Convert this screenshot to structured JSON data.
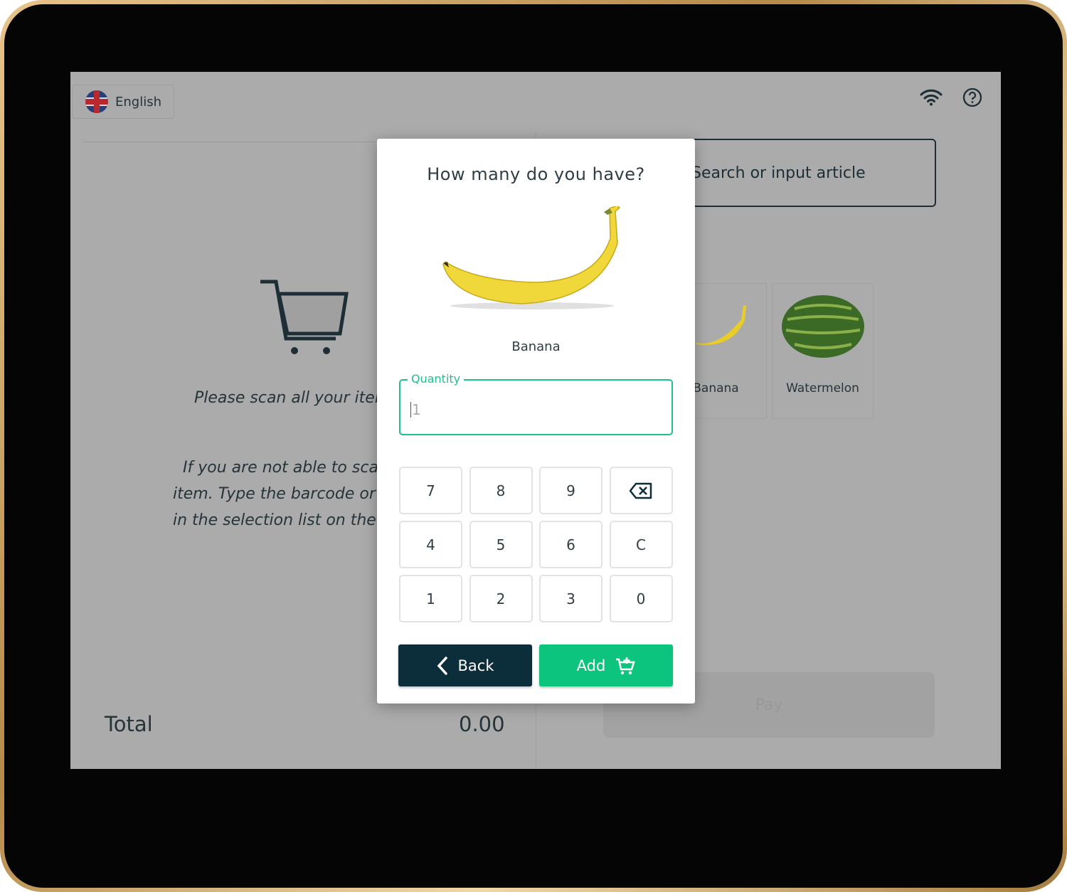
{
  "header": {
    "language": "English",
    "icons": [
      "wifi-icon",
      "help-icon"
    ]
  },
  "search": {
    "placeholder": "Search or input article"
  },
  "left": {
    "scan_text": "Please scan all your items",
    "help_text": [
      "If you are not able to scan an",
      "item. Type the barcode or choose",
      "in the selection list on the right"
    ],
    "total_label": "Total",
    "total_value": "0.00"
  },
  "products": [
    {
      "name": "Banana"
    },
    {
      "name": "Watermelon"
    }
  ],
  "pay_label": "Pay",
  "modal": {
    "title": "How many do you have?",
    "product": "Banana",
    "quantity_label": "Quantity",
    "quantity_value": "1",
    "keys": [
      "7",
      "8",
      "9",
      "backspace",
      "4",
      "5",
      "6",
      "C",
      "1",
      "2",
      "3",
      "0"
    ],
    "back_label": "Back",
    "add_label": "Add"
  },
  "colors": {
    "accent": "#0cc47e",
    "dark": "#0c2e3a"
  }
}
